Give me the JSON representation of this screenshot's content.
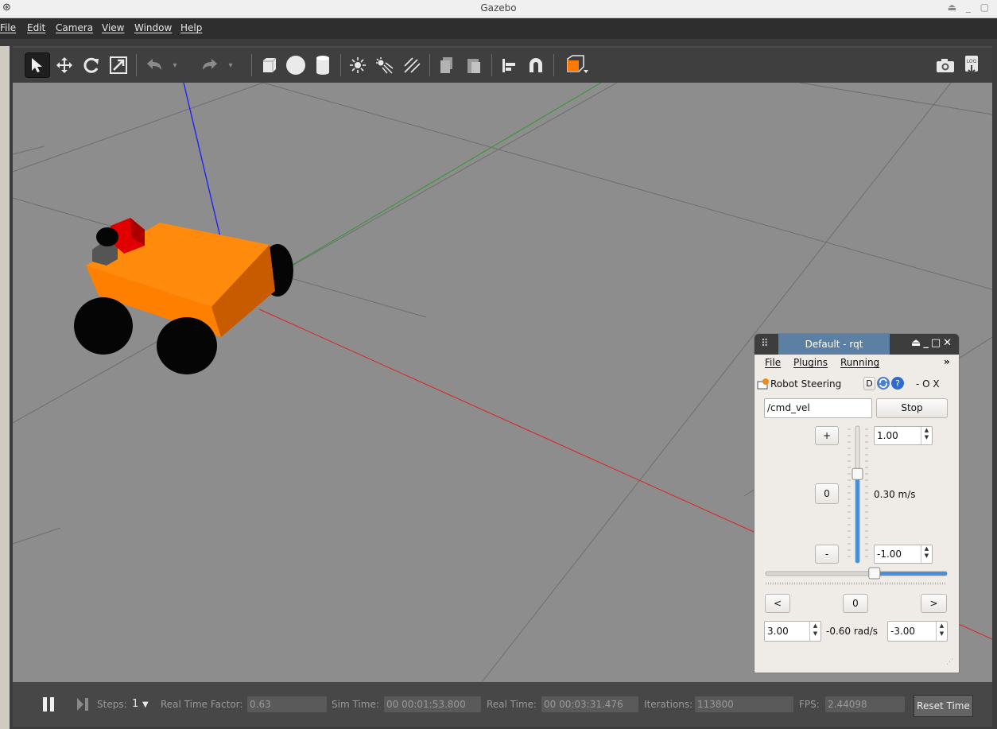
{
  "window": {
    "title": "Gazebo"
  },
  "menubar": {
    "items": [
      "File",
      "Edit",
      "Camera",
      "View",
      "Window",
      "Help"
    ]
  },
  "toolbar": {
    "tools": [
      "select-arrow-icon",
      "translate-icon",
      "rotate-icon",
      "scale-icon",
      "undo-icon",
      "redo-icon",
      "box-shape-icon",
      "sphere-shape-icon",
      "cylinder-shape-icon",
      "point-light-icon",
      "spot-light-icon",
      "directional-light-icon",
      "copy-icon",
      "paste-icon",
      "align-icon",
      "snap-magnet-icon",
      "view-angle-icon",
      "screenshot-camera-icon",
      "log-icon"
    ],
    "log_text": "LOG"
  },
  "bottom": {
    "steps_label": "Steps:",
    "steps_value": "1",
    "rtf_label": "Real Time Factor:",
    "rtf_value": "0.63",
    "sim_time_label": "Sim Time:",
    "sim_time_value": "00 00:01:53.800",
    "real_time_label": "Real Time:",
    "real_time_value": "00 00:03:31.476",
    "iterations_label": "Iterations:",
    "iterations_value": "113800",
    "fps_label": "FPS:",
    "fps_value": "2.44098",
    "reset_label": "Reset Time"
  },
  "rqt": {
    "title": "Default - rqt",
    "menu": [
      "File",
      "Plugins",
      "Running"
    ],
    "more": "»",
    "plugin_name": "Robot Steering",
    "plugin_d": "D",
    "plugin_ctrl": "-  O  X",
    "topic": "/cmd_vel",
    "stop_label": "Stop",
    "plus_label": "+",
    "zero_label": "0",
    "minus_label": "-",
    "max_linear": "1.00",
    "min_linear": "-1.00",
    "linear_readout": "0.30 m/s",
    "linear_level": 0.65,
    "angular_level": 0.6,
    "left_label": "<",
    "right_label": ">",
    "ang_zero_label": "0",
    "max_angular": "3.00",
    "angular_readout": "-0.60 rad/s",
    "min_angular": "-3.00"
  }
}
